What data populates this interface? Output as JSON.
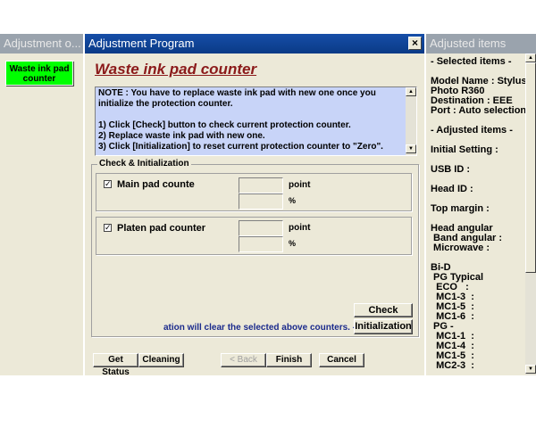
{
  "left_panel": {
    "title": "Adjustment o...",
    "menu_button": "Waste ink pad counter"
  },
  "dialog": {
    "title": "Adjustment Program",
    "close_label": "×",
    "heading": "Waste ink pad counter",
    "note": "NOTE : You have to replace waste ink pad with new one once you initialize the protection counter.\n\n1) Click [Check] button to check current protection counter.\n2) Replace waste ink pad with new one.\n3) Click [Initialization] to reset current protection counter to \"Zero\".",
    "group_title": "Check & Initialization",
    "main_pad": {
      "label": "Main pad counte",
      "checked": true,
      "check_mark": "✓",
      "point_value": "",
      "percent_value": "",
      "point_unit": "point",
      "percent_unit": "%"
    },
    "platen_pad": {
      "label": "Platen pad counter",
      "checked": true,
      "check_mark": "✓",
      "point_value": "",
      "percent_value": "",
      "point_unit": "point",
      "percent_unit": "%"
    },
    "hint": "ation will clear the selected above counters. -->",
    "check_button": "Check",
    "init_button": "Initialization",
    "bottom_buttons": {
      "get_status": "Get Status",
      "cleaning": "Cleaning",
      "back": "< Back",
      "finish": "Finish",
      "cancel": "Cancel"
    }
  },
  "right_panel": {
    "title": "Adjusted items",
    "lines": [
      "- Selected items -",
      "",
      "Model Name : Stylus",
      "Photo R360",
      "Destination : EEE",
      "Port : Auto selection",
      "",
      "- Adjusted items -",
      "",
      "Initial Setting :",
      "",
      "USB ID :",
      "",
      "Head ID :",
      "",
      "Top margin :",
      "",
      "Head angular",
      " Band angular :",
      " Microwave :",
      "",
      "Bi-D",
      " PG Typical",
      "  ECO   :",
      "  MC1-3  :",
      "  MC1-5  :",
      "  MC1-6  :",
      " PG -",
      "  MC1-1  :",
      "  MC1-4  :",
      "  MC1-5  :",
      "  MC2-3  :"
    ]
  },
  "colors": {
    "titlebar_active": "#164ea8",
    "menu_button_green": "#00ff00",
    "note_background": "#c8d4f8",
    "heading_color": "#8b1a1a",
    "hint_color": "#1a2a8c"
  }
}
